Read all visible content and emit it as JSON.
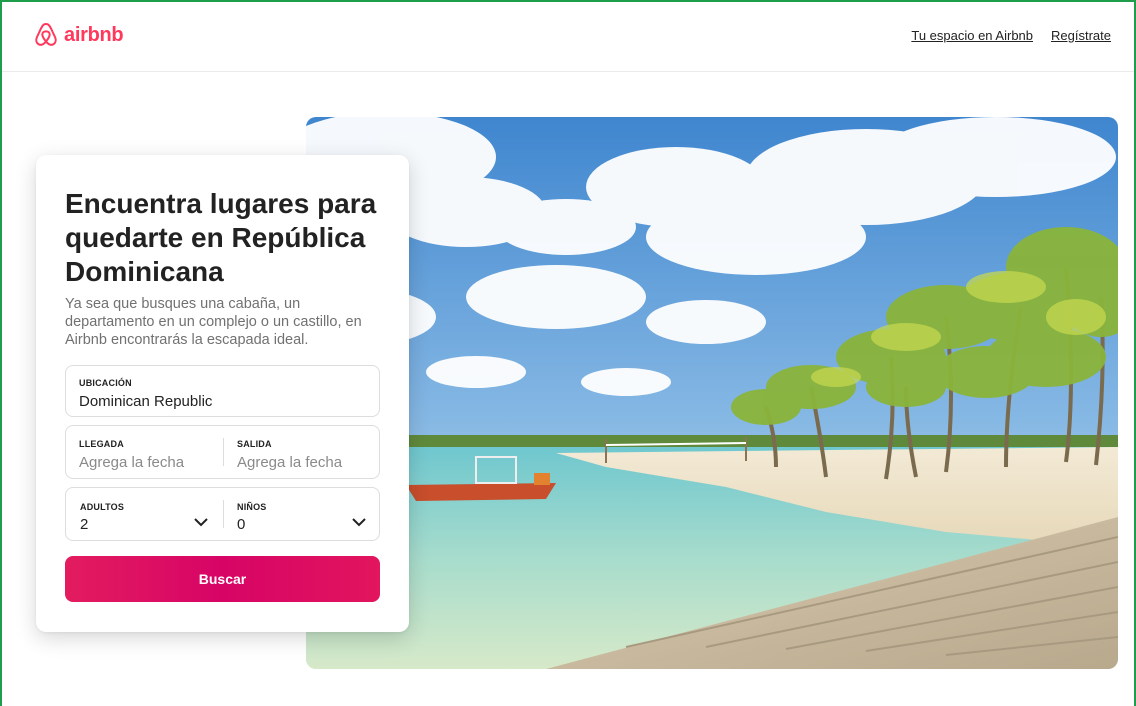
{
  "header": {
    "logo_text": "airbnb",
    "nav": [
      "Tu espacio en Airbnb",
      "Regístrate"
    ]
  },
  "search_card": {
    "title": "Encuentra lugares para quedarte en República Dominicana",
    "description": "Ya sea que busques una cabaña, un departamento en un complejo o un castillo, en Airbnb encontrarás la escapada ideal.",
    "location": {
      "label": "UBICACIÓN",
      "value": "Dominican Republic"
    },
    "checkin": {
      "label": "LLEGADA",
      "placeholder": "Agrega la fecha"
    },
    "checkout": {
      "label": "SALIDA",
      "placeholder": "Agrega la fecha"
    },
    "adults": {
      "label": "ADULTOS",
      "value": "2"
    },
    "children": {
      "label": "NIÑOS",
      "value": "0"
    },
    "search_button": "Buscar"
  },
  "colors": {
    "brand": "#ff385c",
    "button": "#e31c5f",
    "frame": "#1e9e4a"
  },
  "icons": [
    "airbnb-logo-icon",
    "chevron-down-icon"
  ]
}
